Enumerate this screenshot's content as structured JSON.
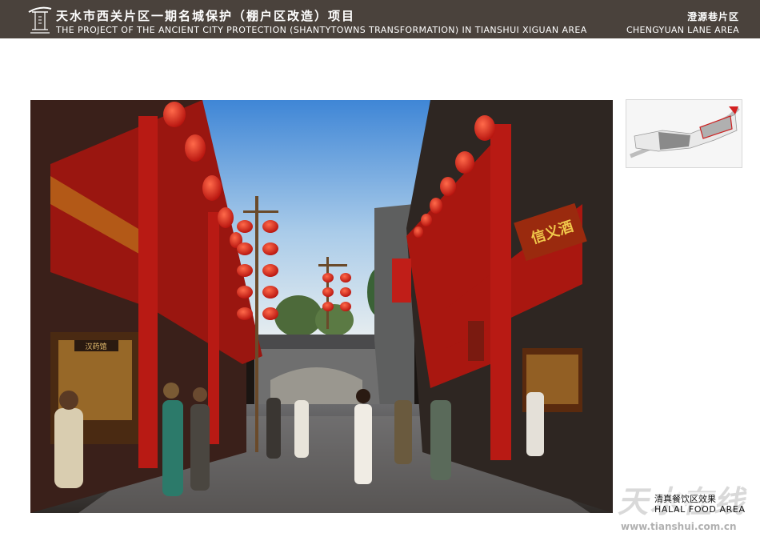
{
  "header": {
    "title_cn": "天水市西关片区一期名城保护（棚户区改造）项目",
    "title_en": "THE PROJECT OF THE ANCIENT CITY PROTECTION (SHANTYTOWNS TRANSFORMATION) IN TIANSHUI XIGUAN AREA",
    "area_cn": "澄源巷片区",
    "area_en": "CHENGYUAN LANE AREA"
  },
  "render": {
    "sign_right": "信义酒",
    "sign_left_shop": "汉药馆"
  },
  "caption": {
    "cn": "清真餐饮区效果",
    "en": "HALAL FOOD AREA"
  },
  "watermark": {
    "text": "天水在线",
    "url": "www.tianshui.com.cn"
  },
  "colors": {
    "header_bg": "#4a423c",
    "lantern": "#e0201a",
    "timber_red": "#b81a14"
  }
}
